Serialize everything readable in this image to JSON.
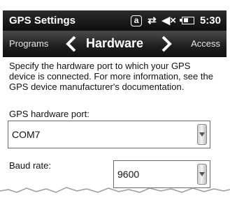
{
  "titlebar": {
    "title": "GPS Settings",
    "a_icon": "a",
    "connectivity_icon": "sync-arrows-icon",
    "sound_icon": "speaker-muted-icon",
    "battery_icon": "battery-charging-icon",
    "time": "5:30"
  },
  "tabs": {
    "prev": "Programs",
    "current": "Hardware",
    "next": "Access"
  },
  "content": {
    "description": "Specify the hardware port to which your GPS device is connected. For more information, see the GPS device manufacturer's documentation.",
    "port_label": "GPS hardware port:",
    "port_value": "COM7",
    "baud_label": "Baud rate:",
    "baud_value": "9600"
  }
}
